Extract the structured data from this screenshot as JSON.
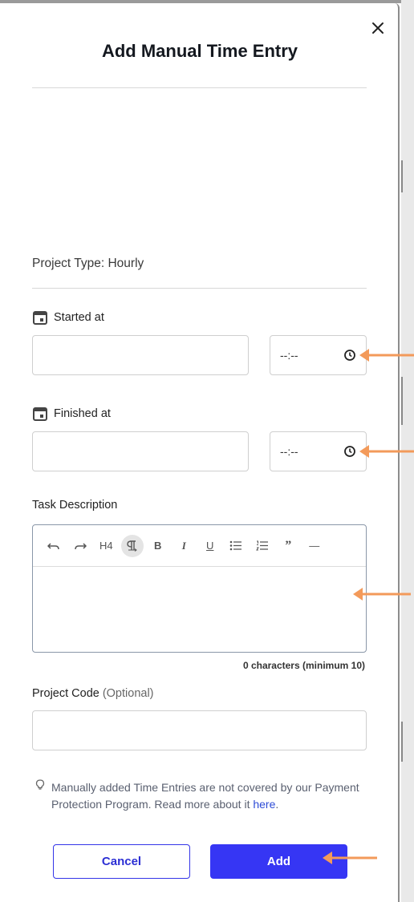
{
  "modal": {
    "title": "Add Manual Time Entry",
    "close_icon": "close-icon"
  },
  "project_type": "Project Type: Hourly",
  "started": {
    "label": "Started at",
    "date_value": "",
    "time_value": "--:--",
    "icons": [
      "calendar-icon",
      "clock-icon"
    ]
  },
  "finished": {
    "label": "Finished at",
    "date_value": "",
    "time_value": "--:--",
    "icons": [
      "calendar-icon",
      "clock-icon"
    ]
  },
  "task": {
    "label": "Task Description",
    "toolbar": {
      "undo": "undo-icon",
      "redo": "redo-icon",
      "h4": "H4",
      "paragraph": "paragraph-icon",
      "bold": "B",
      "italic": "I",
      "underline": "U",
      "bullet_list": "bullet-list-icon",
      "numbered_list": "numbered-list-icon",
      "quote": "”",
      "horizontal_rule": "—"
    },
    "value": "",
    "char_count": "0 characters (minimum 10)"
  },
  "project_code": {
    "label": "Project Code",
    "optional": "(Optional)",
    "value": ""
  },
  "info": {
    "icon": "lightbulb-icon",
    "text": "Manually added Time Entries are not covered by our Payment Protection Program. Read more about it ",
    "link": "here",
    "end": "."
  },
  "buttons": {
    "cancel": "Cancel",
    "add": "Add"
  },
  "colors": {
    "accent": "#3636f4",
    "annotation_arrow": "#f39a5a"
  }
}
